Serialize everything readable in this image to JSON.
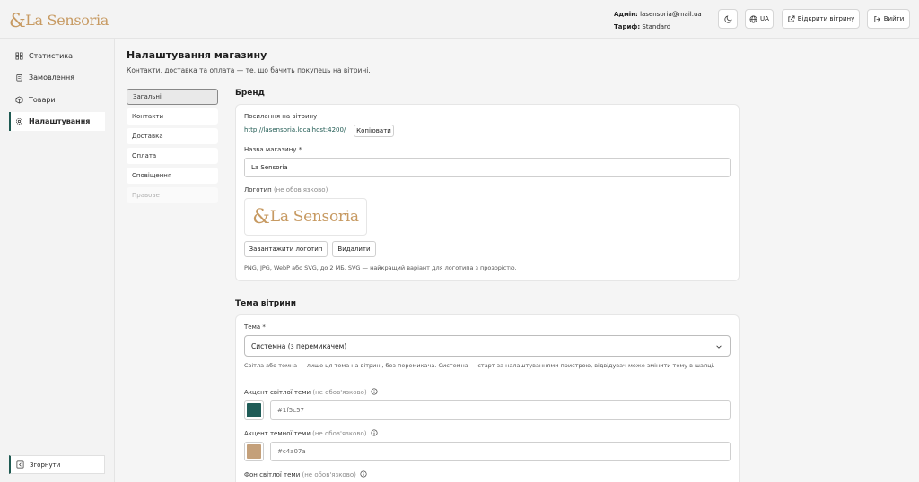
{
  "app": {
    "logo_mark": "&",
    "logo_text": "La Sensoria"
  },
  "header": {
    "admin_label": "Адмін:",
    "admin_email": "lasensoria@mail.ua",
    "plan_label": "Тариф:",
    "plan_value": "Standard",
    "theme_toggle_icon": "moon-icon",
    "language": "UA",
    "open_storefront": "Відкрити вітрину",
    "logout": "Вийти"
  },
  "sidebar": {
    "items": [
      {
        "label": "Статистика",
        "icon": "chart-icon"
      },
      {
        "label": "Замовлення",
        "icon": "clipboard-icon"
      },
      {
        "label": "Товари",
        "icon": "box-icon"
      },
      {
        "label": "Налаштування",
        "icon": "gear-icon",
        "active": true
      }
    ],
    "collapse": "Згорнути"
  },
  "page": {
    "title": "Налаштування магазину",
    "subtitle": "Контакти, доставка та оплата — те, що бачить покупець на вітрині."
  },
  "subnav": [
    {
      "label": "Загальні",
      "active": true
    },
    {
      "label": "Контакти"
    },
    {
      "label": "Доставка"
    },
    {
      "label": "Оплата"
    },
    {
      "label": "Сповіщення"
    },
    {
      "label": "Правове",
      "disabled": true
    }
  ],
  "brand": {
    "section_title": "Бренд",
    "storefront_link_label": "Посилання на вітрину",
    "storefront_link": "http://lasensoria.localhost:4200/",
    "copy_button": "Копіювати",
    "store_name_label": "Назва магазину",
    "required_mark": "*",
    "store_name_value": "La Sensoria",
    "logo_label": "Логотип",
    "optional": "(не обов'язково)",
    "upload_button": "Завантажити логотип",
    "delete_button": "Видалити",
    "logo_hint": "PNG, JPG, WebP або SVG, до 2 МБ. SVG — найкращий варіант для логотипа з прозорістю."
  },
  "theme": {
    "section_title": "Тема вітрини",
    "theme_label": "Тема",
    "theme_value": "Системна (з перемикачем)",
    "theme_hint": "Світла або темна — лише ця тема на вітрині, без перемикача. Системна — старт за налаштуваннями пристрою, відвідувач може змінити тему в шапці.",
    "accent_light_label": "Акцент світлої теми",
    "accent_light_value": "#1f5c57",
    "accent_dark_label": "Акцент темної теми",
    "accent_dark_value": "#c4a07a",
    "bg_light_label": "Фон світлої теми"
  }
}
